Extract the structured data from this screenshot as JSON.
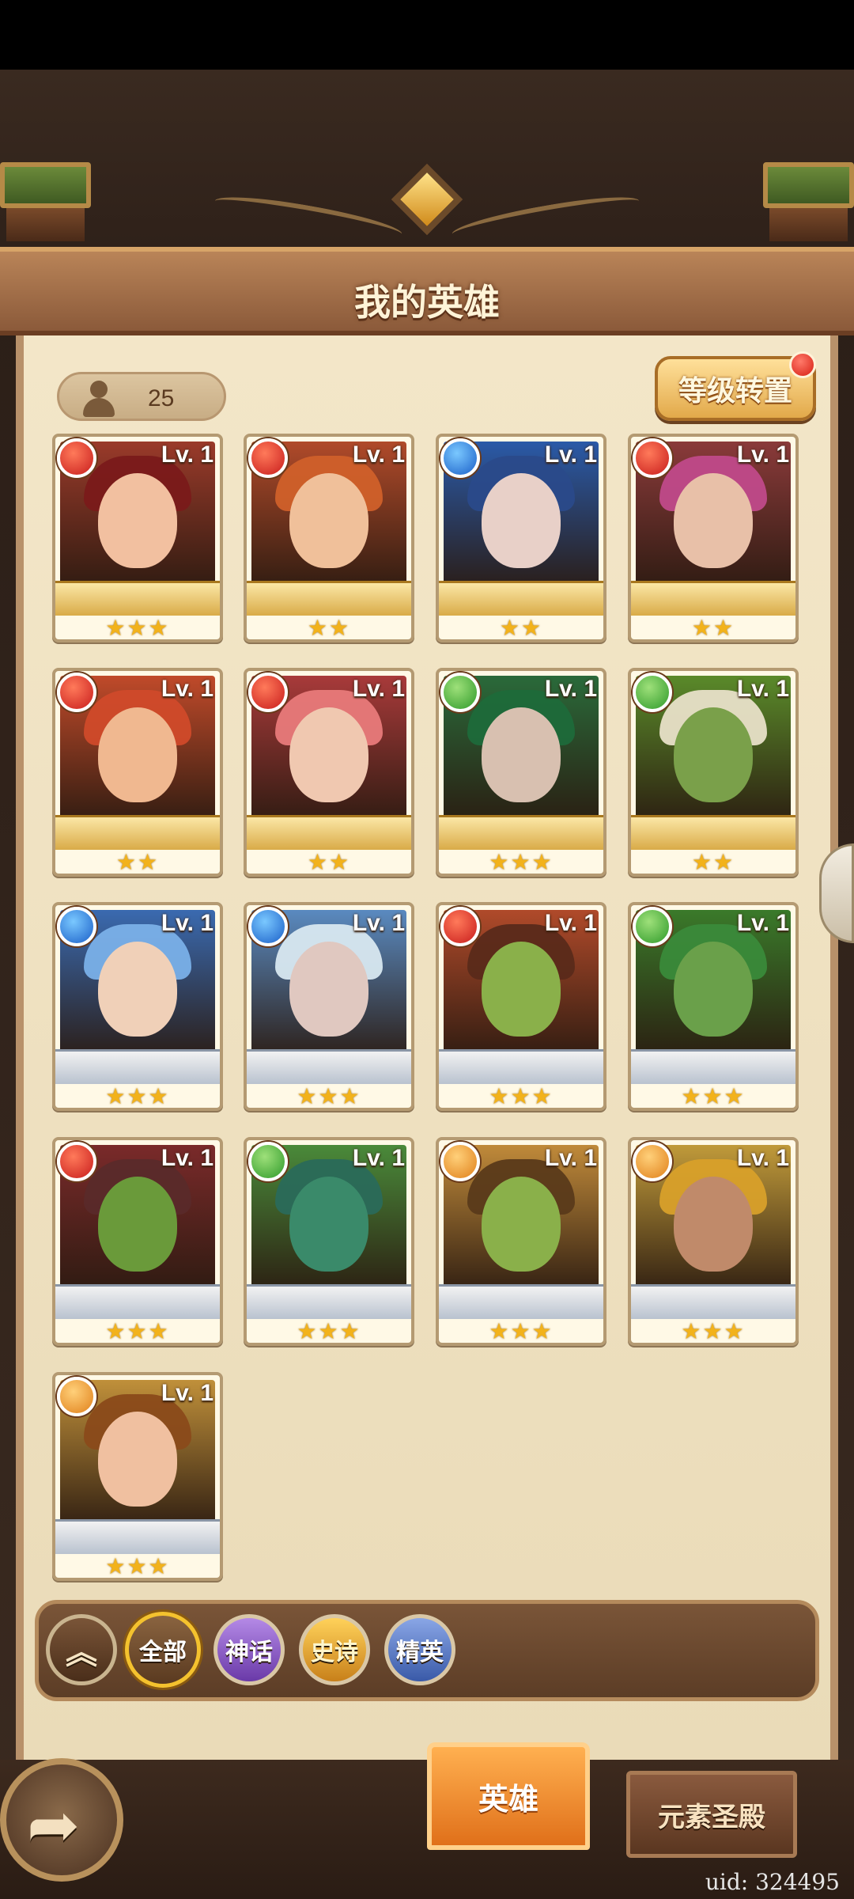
{
  "header": {
    "title": "我的英雄"
  },
  "hero_count": "25",
  "level_reset_label": "等级转置",
  "heroes": [
    {
      "level": "Lv. 1",
      "element": "fire",
      "stars": "★★★",
      "frame": "gold",
      "skin": "#f2c0a0",
      "hair": "#7a1a1a",
      "bg": "#9a3a2a"
    },
    {
      "level": "Lv. 1",
      "element": "fire",
      "stars": "★★",
      "frame": "gold",
      "skin": "#f0c09a",
      "hair": "#d0602a",
      "bg": "#b04a2a"
    },
    {
      "level": "Lv. 1",
      "element": "water",
      "stars": "★★",
      "frame": "gold",
      "skin": "#e8d0c8",
      "hair": "#2a4a8a",
      "bg": "#2a5aa8"
    },
    {
      "level": "Lv. 1",
      "element": "fire",
      "stars": "★★",
      "frame": "gold",
      "skin": "#e8c0a8",
      "hair": "#c04a8a",
      "bg": "#8a3a3a"
    },
    {
      "level": "Lv. 1",
      "element": "fire",
      "stars": "★★",
      "frame": "gold",
      "skin": "#f0b890",
      "hair": "#d04a2a",
      "bg": "#c04a2a"
    },
    {
      "level": "Lv. 1",
      "element": "fire",
      "stars": "★★",
      "frame": "gold",
      "skin": "#f0c8b0",
      "hair": "#e87a7a",
      "bg": "#a83a3a"
    },
    {
      "level": "Lv. 1",
      "element": "nature",
      "stars": "★★★",
      "frame": "gold",
      "skin": "#d8c0b0",
      "hair": "#1e6a3a",
      "bg": "#2a6a3a"
    },
    {
      "level": "Lv. 1",
      "element": "nature",
      "stars": "★★",
      "frame": "gold",
      "skin": "#7aa04a",
      "hair": "#e8e0c8",
      "bg": "#5a8a2a"
    },
    {
      "level": "Lv. 1",
      "element": "water",
      "stars": "★★★",
      "frame": "silver",
      "skin": "#f0d0b8",
      "hair": "#7ab0e8",
      "bg": "#3a6ab0"
    },
    {
      "level": "Lv. 1",
      "element": "water",
      "stars": "★★★",
      "frame": "silver",
      "skin": "#e0c8c0",
      "hair": "#d8e8f0",
      "bg": "#5a8ac0"
    },
    {
      "level": "Lv. 1",
      "element": "fire",
      "stars": "★★★",
      "frame": "silver",
      "skin": "#8ab04a",
      "hair": "#5a2a1a",
      "bg": "#b04a2a"
    },
    {
      "level": "Lv. 1",
      "element": "nature",
      "stars": "★★★",
      "frame": "silver",
      "skin": "#6aa04a",
      "hair": "#3a8a3a",
      "bg": "#3a7a2a"
    },
    {
      "level": "Lv. 1",
      "element": "fire",
      "stars": "★★★",
      "frame": "silver",
      "skin": "#6a9a3a",
      "hair": "#5a2a2a",
      "bg": "#7a2a2a"
    },
    {
      "level": "Lv. 1",
      "element": "nature",
      "stars": "★★★",
      "frame": "silver",
      "skin": "#3a8a6a",
      "hair": "#2a6a5a",
      "bg": "#4a8a3a"
    },
    {
      "level": "Lv. 1",
      "element": "light",
      "stars": "★★★",
      "frame": "silver",
      "skin": "#8ab04a",
      "hair": "#5a3a1a",
      "bg": "#c08a3a"
    },
    {
      "level": "Lv. 1",
      "element": "light",
      "stars": "★★★",
      "frame": "silver",
      "skin": "#c08a6a",
      "hair": "#d8a02a",
      "bg": "#c09a3a"
    },
    {
      "level": "Lv. 1",
      "element": "light",
      "stars": "★★★",
      "frame": "silver",
      "skin": "#f0c0a0",
      "hair": "#8a4a1a",
      "bg": "#c0903a"
    }
  ],
  "filters": {
    "collapse_icon": "︽",
    "all": "全部",
    "myth": "神话",
    "epic": "史诗",
    "elite": "精英"
  },
  "tabs": {
    "heroes": "英雄",
    "temple": "元素圣殿"
  },
  "back_icon": "➦",
  "uid": "uid: 324495"
}
